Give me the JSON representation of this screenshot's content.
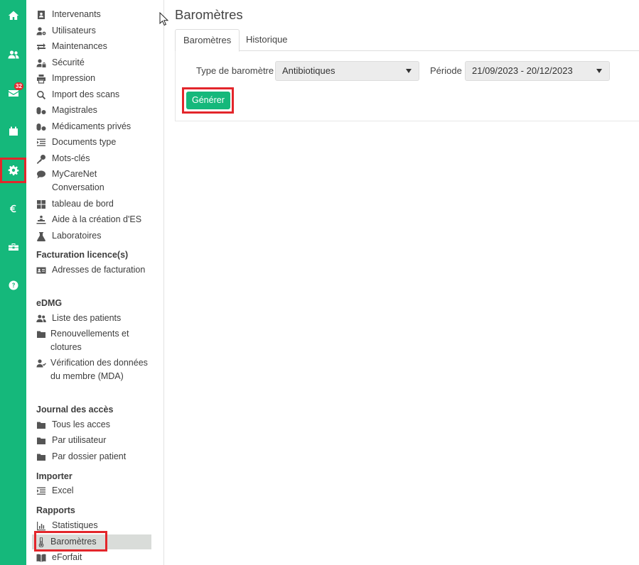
{
  "rail": {
    "items": [
      {
        "icon": "home-icon"
      },
      {
        "icon": "users-icon"
      },
      {
        "icon": "mail-icon",
        "badge": "32"
      },
      {
        "icon": "calendar-icon"
      },
      {
        "icon": "gear-icon"
      },
      {
        "icon": "euro-icon"
      },
      {
        "icon": "toolbox-icon"
      },
      {
        "icon": "help-icon"
      }
    ],
    "color": "#15b87b"
  },
  "sidebar": {
    "items": [
      {
        "label": "Intervenants",
        "icon": "id-badge-icon"
      },
      {
        "label": "Utilisateurs",
        "icon": "user-cog-icon"
      },
      {
        "label": "Maintenances",
        "icon": "exchange-icon"
      },
      {
        "label": "Sécurité",
        "icon": "user-lock-icon"
      },
      {
        "label": "Impression",
        "icon": "printer-icon"
      },
      {
        "label": "Import des scans",
        "icon": "search-icon"
      },
      {
        "label": "Magistrales",
        "icon": "pills-icon"
      },
      {
        "label": "Médicaments privés",
        "icon": "pills-icon"
      },
      {
        "label": "Documents type",
        "icon": "indent-icon"
      },
      {
        "label": "Mots-clés",
        "icon": "key-icon"
      },
      {
        "label": "MyCareNet Conversation",
        "icon": "comment-icon"
      },
      {
        "label": "tableau de bord",
        "icon": "dashboard-icon"
      },
      {
        "label": "Aide à la création d'ES",
        "icon": "procedure-icon"
      },
      {
        "label": "Laboratoires",
        "icon": "flask-icon"
      }
    ],
    "sections": {
      "facturation": {
        "title": "Facturation licence(s)",
        "items": [
          {
            "label": "Adresses de facturation",
            "icon": "address-card-icon"
          }
        ]
      },
      "edmg": {
        "title": "eDMG",
        "items": [
          {
            "label": "Liste des patients",
            "icon": "users-icon"
          },
          {
            "label": "Renouvellements et clotures",
            "icon": "folder-icon"
          },
          {
            "label": "Vérification des données du membre (MDA)",
            "icon": "user-check-icon"
          }
        ]
      },
      "journal": {
        "title": "Journal des accès",
        "items": [
          {
            "label": "Tous les acces",
            "icon": "folder-icon"
          },
          {
            "label": "Par utilisateur",
            "icon": "folder-icon"
          },
          {
            "label": "Par dossier patient",
            "icon": "folder-icon"
          }
        ]
      },
      "importer": {
        "title": "Importer",
        "items": [
          {
            "label": "Excel",
            "icon": "indent-icon"
          }
        ]
      },
      "rapports": {
        "title": "Rapports",
        "items": [
          {
            "label": "Statistiques",
            "icon": "bar-chart-icon"
          },
          {
            "label": "Baromètres",
            "icon": "thermometer-icon",
            "active": true
          },
          {
            "label": "eForfait",
            "icon": "book-icon"
          }
        ]
      }
    }
  },
  "main": {
    "title": "Baromètres",
    "tabs": [
      {
        "label": "Baromètres",
        "active": true
      },
      {
        "label": "Historique",
        "active": false
      }
    ],
    "form": {
      "type_label": "Type de baromètre",
      "type_value": "Antibiotiques",
      "period_label": "Période",
      "period_value": "21/09/2023 - 20/12/2023",
      "generate_label": "Générer"
    }
  },
  "colors": {
    "accent": "#15b87b",
    "highlight": "#e3262b",
    "active_bg": "#d9dcd9"
  }
}
